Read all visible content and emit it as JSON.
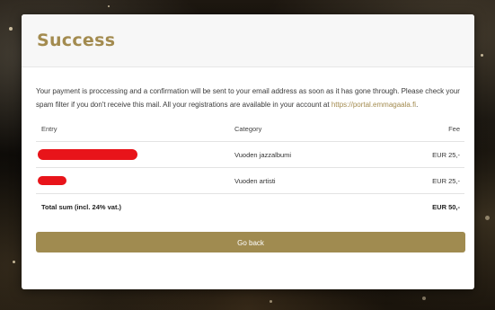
{
  "card": {
    "title": "Success",
    "message": "Your payment is proccessing and a confirmation will be sent to your email address as soon as it has gone through. Please check your spam filter if you don't receive this mail. All your registrations are available in your account at",
    "link_text": "https://portal.emmagaala.fi",
    "link_suffix": "."
  },
  "table": {
    "headers": {
      "entry": "Entry",
      "category": "Category",
      "fee": "Fee"
    },
    "rows": [
      {
        "category": "Vuoden jazzalbumi",
        "fee": "EUR 25,-"
      },
      {
        "category": "Vuoden artisti",
        "fee": "EUR 25,-"
      }
    ],
    "total": {
      "label": "Total sum (incl. 24% vat.)",
      "fee": "EUR 50,-"
    }
  },
  "button": {
    "label": "Go back"
  },
  "colors": {
    "accent": "#a38b4f",
    "redaction": "#e8141a"
  }
}
